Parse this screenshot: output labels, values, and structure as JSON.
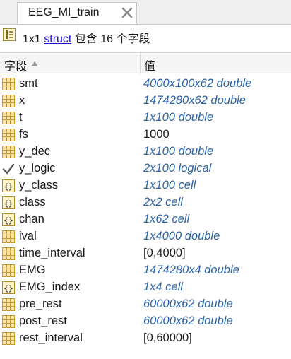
{
  "tab": {
    "title": "EEG_MI_train",
    "close_icon": "close-icon"
  },
  "info": {
    "prefix": "1x1 ",
    "link": "struct",
    "suffix": " 包含 16 个字段"
  },
  "columns": {
    "field": "字段",
    "value": "值"
  },
  "colors": {
    "italic_value": "#2a62a8",
    "link": "#1a0dcc",
    "grid_icon": "#c49a2a"
  },
  "fields": [
    {
      "name": "smt",
      "value": "4000x100x62 double",
      "icon": "matrix-icon",
      "italic": true
    },
    {
      "name": "x",
      "value": "1474280x62 double",
      "icon": "matrix-icon",
      "italic": true
    },
    {
      "name": "t",
      "value": "1x100 double",
      "icon": "matrix-icon",
      "italic": true
    },
    {
      "name": "fs",
      "value": "1000",
      "icon": "matrix-icon",
      "italic": false
    },
    {
      "name": "y_dec",
      "value": "1x100 double",
      "icon": "matrix-icon",
      "italic": true
    },
    {
      "name": "y_logic",
      "value": "2x100 logical",
      "icon": "checkmark-icon",
      "italic": true
    },
    {
      "name": "y_class",
      "value": "1x100 cell",
      "icon": "cell-icon",
      "italic": true
    },
    {
      "name": "class",
      "value": "2x2 cell",
      "icon": "cell-icon",
      "italic": true
    },
    {
      "name": "chan",
      "value": "1x62 cell",
      "icon": "cell-icon",
      "italic": true
    },
    {
      "name": "ival",
      "value": "1x4000 double",
      "icon": "matrix-icon",
      "italic": true
    },
    {
      "name": "time_interval",
      "value": "[0,4000]",
      "icon": "matrix-icon",
      "italic": false
    },
    {
      "name": "EMG",
      "value": "1474280x4 double",
      "icon": "matrix-icon",
      "italic": true
    },
    {
      "name": "EMG_index",
      "value": "1x4 cell",
      "icon": "cell-icon",
      "italic": true
    },
    {
      "name": "pre_rest",
      "value": "60000x62 double",
      "icon": "matrix-icon",
      "italic": true
    },
    {
      "name": "post_rest",
      "value": "60000x62 double",
      "icon": "matrix-icon",
      "italic": true
    },
    {
      "name": "rest_interval",
      "value": "[0,60000]",
      "icon": "matrix-icon",
      "italic": false
    }
  ]
}
